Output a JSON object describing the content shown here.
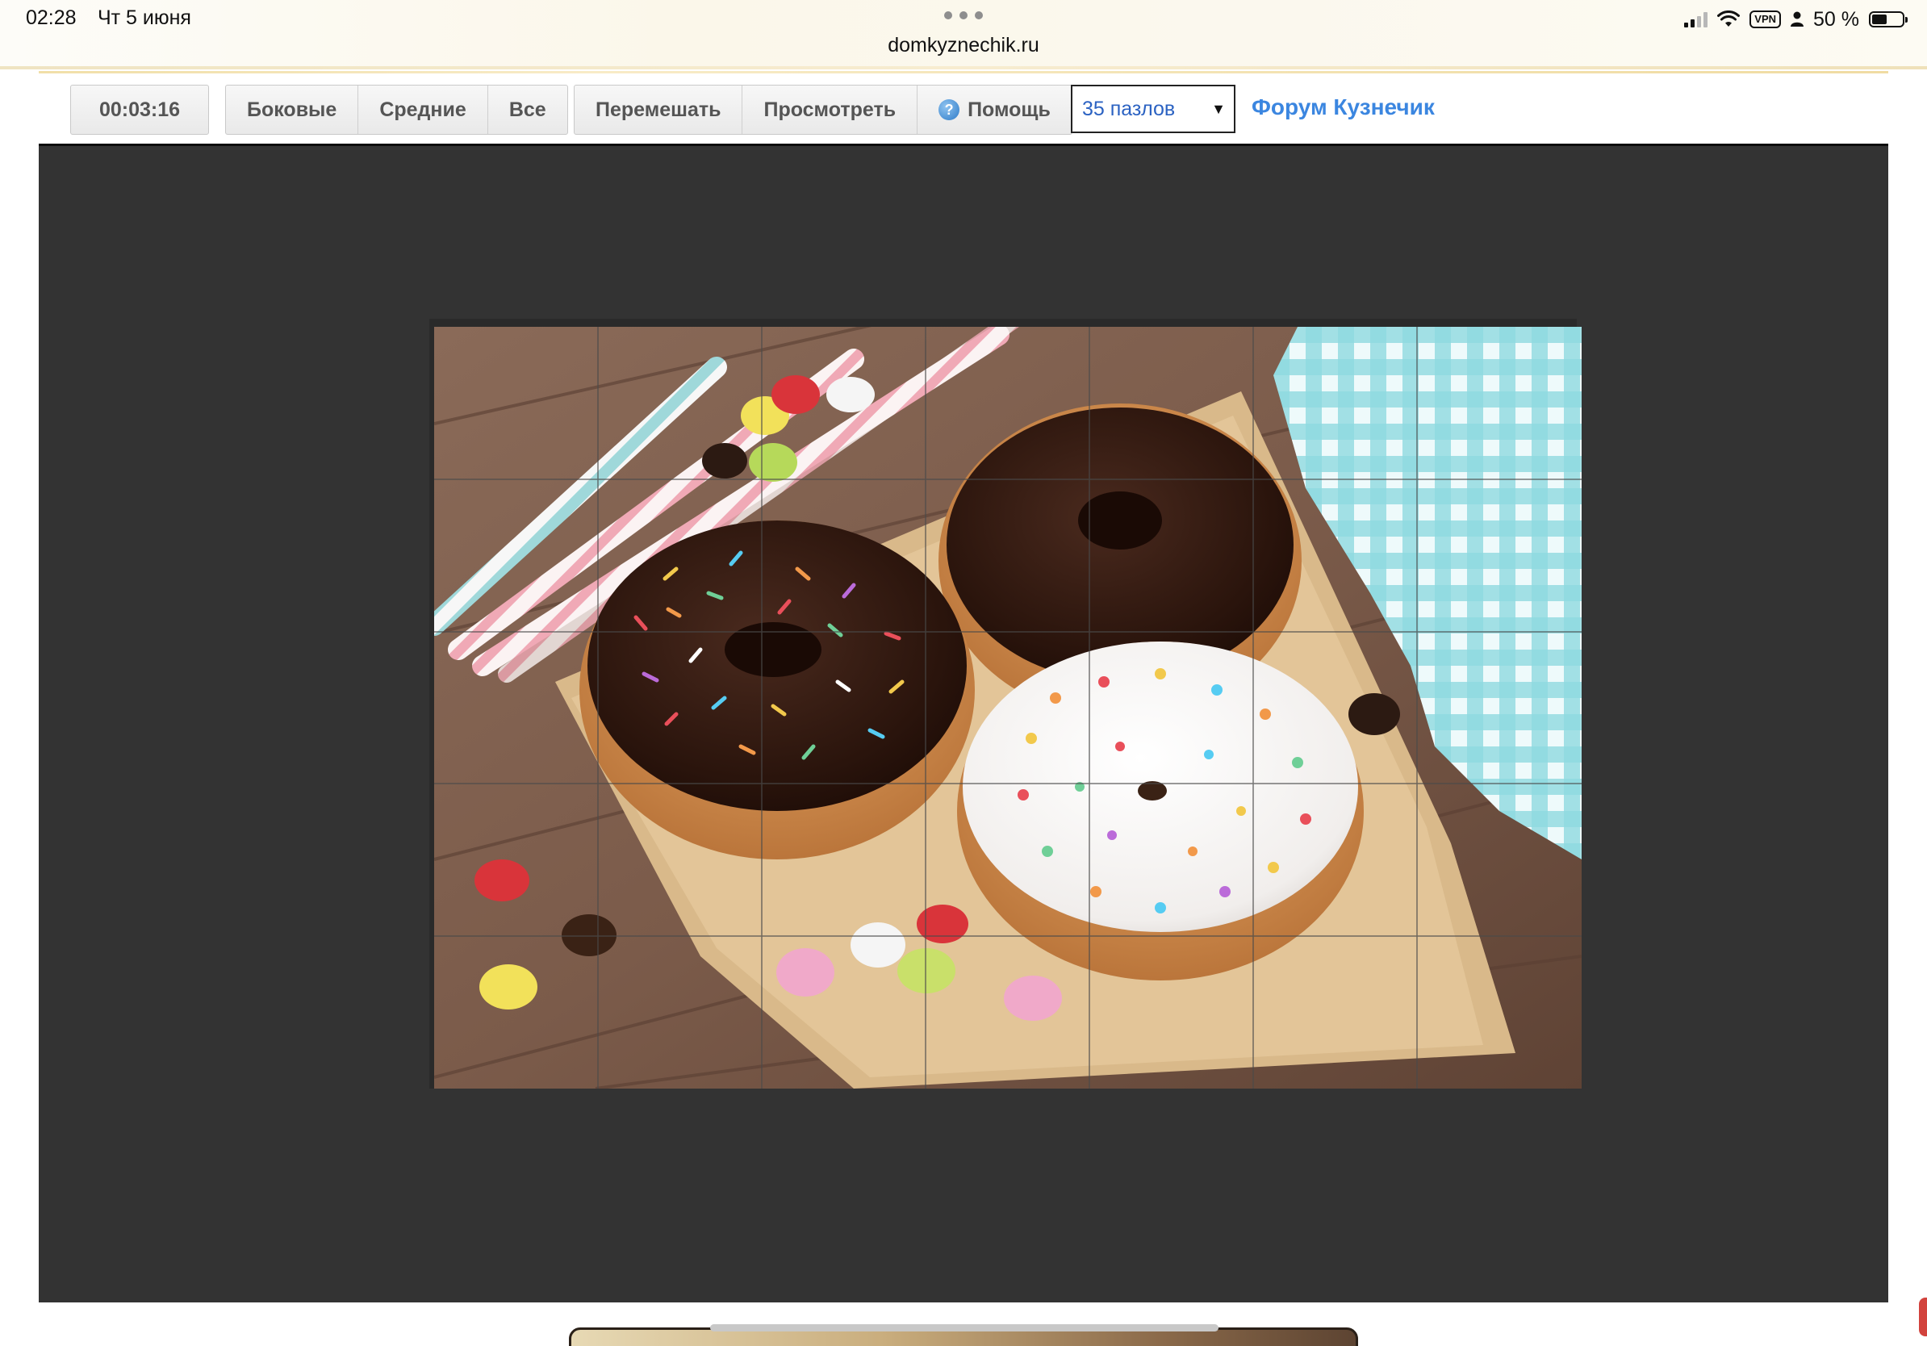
{
  "status_bar": {
    "time": "02:28",
    "date": "Чт 5 июня",
    "url": "domkyznechik.ru",
    "vpn": "VPN",
    "battery": "50 %",
    "battery_level_percent": 50
  },
  "toolbar": {
    "timer": "00:03:16",
    "filter_buttons": [
      "Боковые",
      "Средние",
      "Все"
    ],
    "action_buttons": {
      "shuffle": "Перемешать",
      "preview": "Просмотреть",
      "help": "Помощь"
    },
    "pieces_select": {
      "selected": "35 пазлов"
    },
    "forum_link": "Форум Кузнечик"
  },
  "puzzle": {
    "columns": 7,
    "rows": 5,
    "subject": "donuts-on-wooden-table"
  },
  "colors": {
    "stage_background": "#333333",
    "link_blue": "#3b86e0",
    "select_text": "#2b62c2"
  }
}
